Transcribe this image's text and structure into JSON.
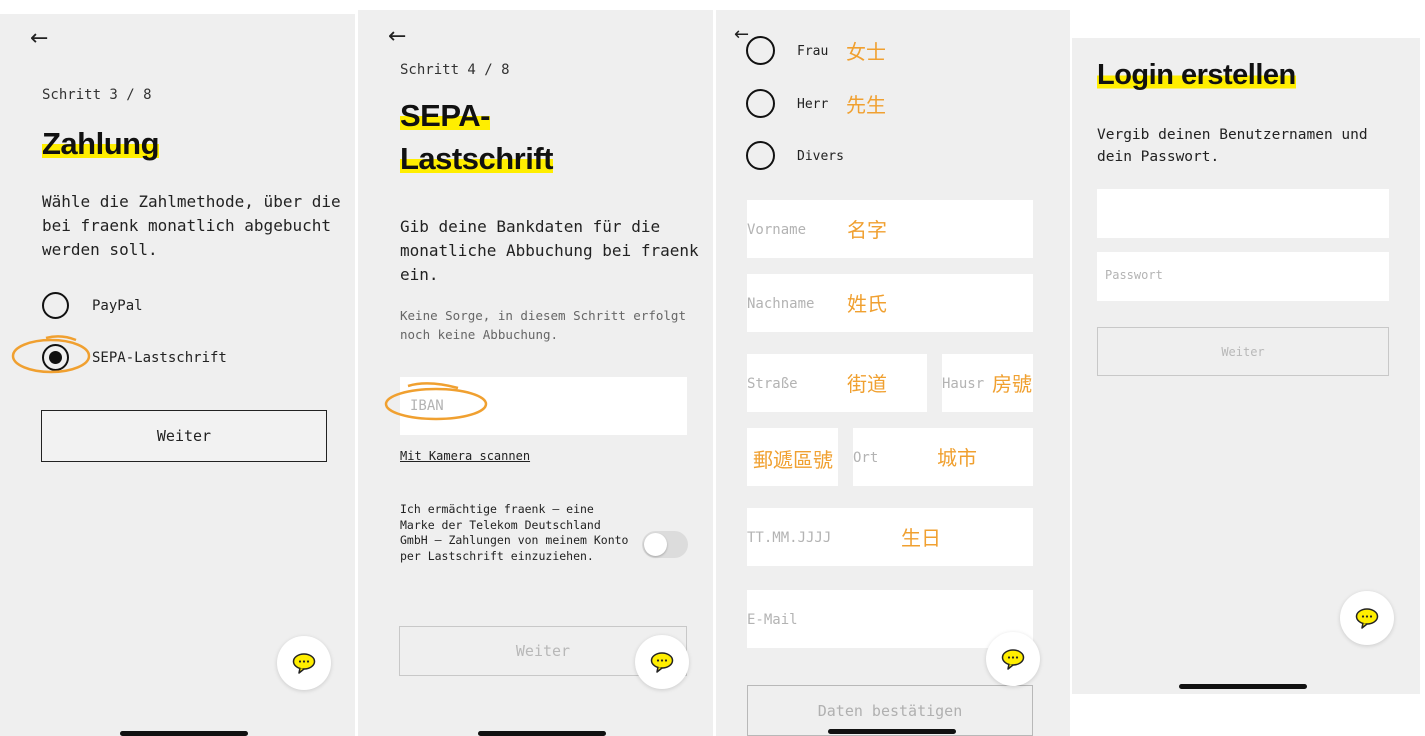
{
  "screen1": {
    "step": "Schritt 3 / 8",
    "title": "Zahlung",
    "description": "Wähle die Zahlmethode, über die bei fraenk monatlich abgebucht werden soll.",
    "options": [
      "PayPal",
      "SEPA-Lastschrift"
    ],
    "selected_option": "SEPA-Lastschrift",
    "button": "Weiter"
  },
  "screen2": {
    "step": "Schritt 4 / 8",
    "title_line1": "SEPA-",
    "title_line2": "Lastschrift",
    "description": "Gib deine Bankdaten für die monatliche Abbuchung bei fraenk ein.",
    "note": "Keine Sorge, in diesem Schritt erfolgt noch keine Abbuchung.",
    "iban_placeholder": "IBAN",
    "camera_link": "Mit Kamera scannen",
    "mandate": "Ich ermächtige fraenk – eine Marke der Telekom Deutschland GmbH – Zahlungen von meinem Konto per Lastschrift einzuziehen.",
    "button": "Weiter"
  },
  "screen3": {
    "salutations": [
      {
        "label": "Frau",
        "annotation": "女士"
      },
      {
        "label": "Herr",
        "annotation": "先生"
      },
      {
        "label": "Divers",
        "annotation": ""
      }
    ],
    "fields": {
      "first_name": {
        "placeholder": "Vorname",
        "annotation": "名字"
      },
      "last_name": {
        "placeholder": "Nachname",
        "annotation": "姓氏"
      },
      "street": {
        "placeholder": "Straße",
        "annotation": "街道"
      },
      "house_number": {
        "placeholder": "Hausr",
        "annotation": "房號"
      },
      "postal_code": {
        "placeholder": "",
        "annotation": "郵遞區號"
      },
      "city": {
        "placeholder": "Ort",
        "annotation": "城市"
      },
      "birthdate": {
        "placeholder": "TT.MM.JJJJ",
        "annotation": "生日"
      },
      "email": {
        "placeholder": "E-Mail",
        "annotation": ""
      }
    },
    "button": "Daten bestätigen"
  },
  "screen4": {
    "title": "Login erstellen",
    "description": "Vergib deinen Benutzernamen und dein Passwort.",
    "username_value": "",
    "password_placeholder": "Passwort",
    "button": "Weiter"
  },
  "colors": {
    "highlight": "#ffee00",
    "annotation": "#f0a030",
    "panel_bg": "#efefef"
  }
}
